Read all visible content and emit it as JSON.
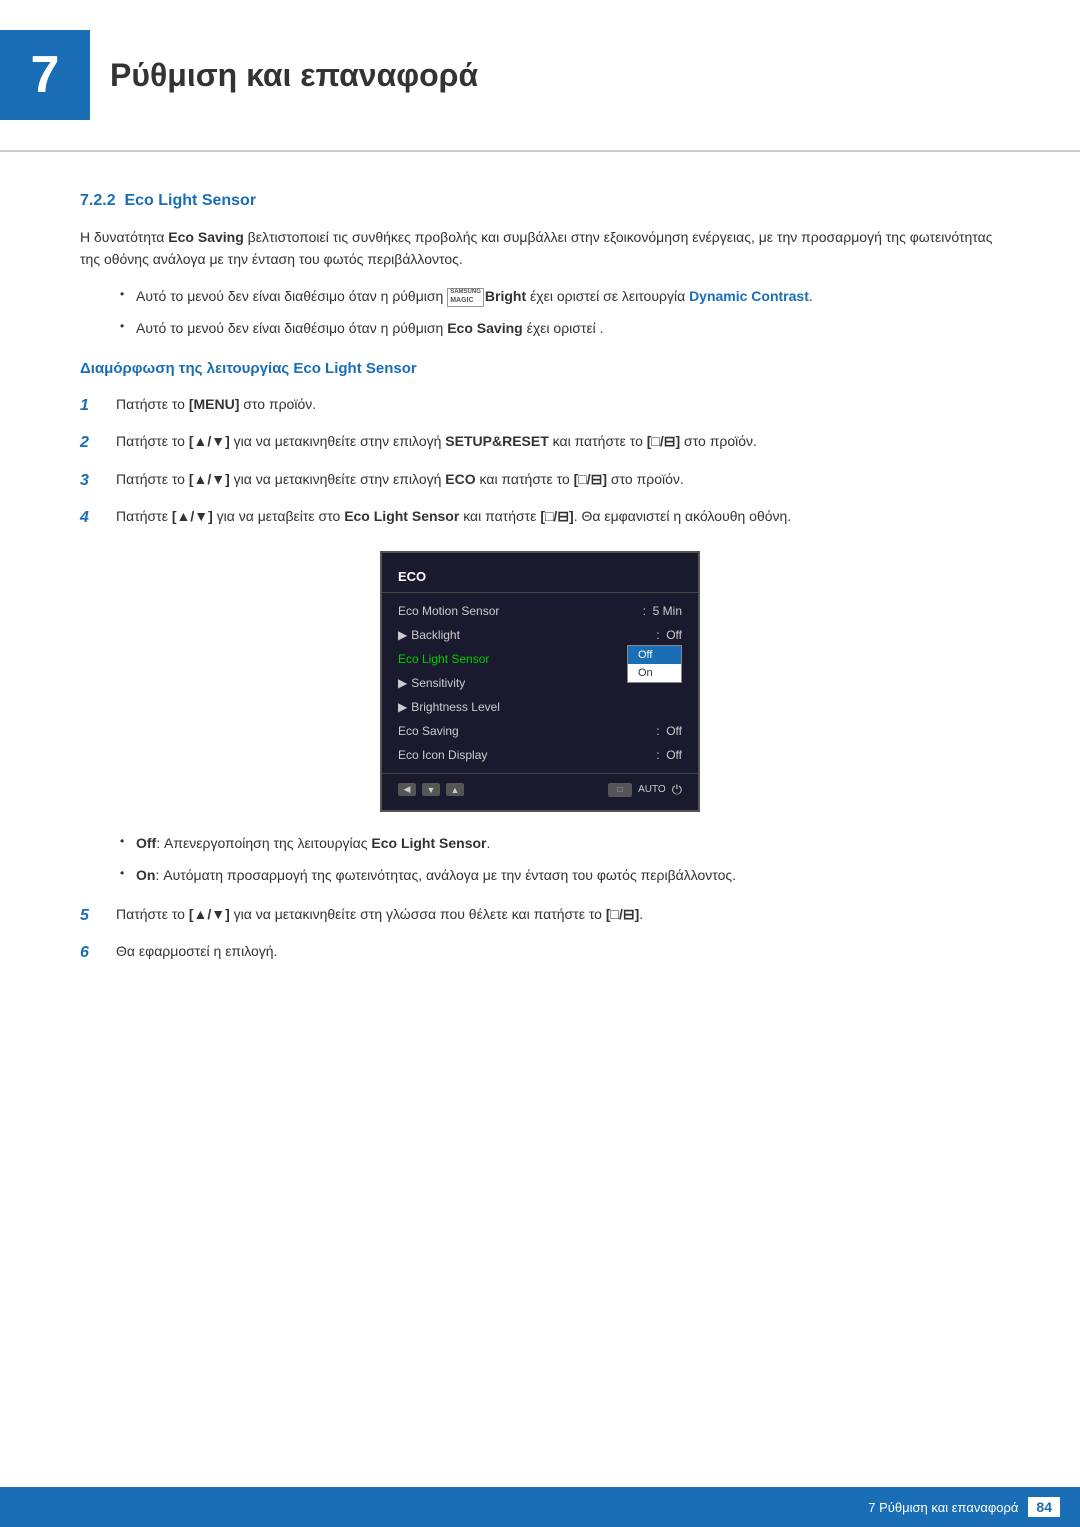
{
  "chapter": {
    "number": "7",
    "title": "Ρύθμιση και επαναφορά"
  },
  "section": {
    "id": "7.2.2",
    "title": "Eco Light Sensor"
  },
  "intro_text": "Η δυνατότητα Eco Saving βελτιστοποιεί τις συνθήκες προβολής και συμβάλλει στην εξοικονόμηση ενέργειας, με την προσαρμογή της φωτεινότητας της οθόνης ανάλογα με την ένταση του φωτός περιβάλλοντος.",
  "bullets": [
    {
      "text_before": "Αυτό το μενού δεν είναι διαθέσιμο όταν η ρύθμιση ",
      "badge": "SAMSUNG MAGIC",
      "bold_word": "Bright",
      "text_after": " έχει οριστεί σε λειτουργία ",
      "blue_word": "Dynamic Contrast",
      "end": "."
    },
    {
      "text_before": "Αυτό το μενού δεν είναι διαθέσιμο όταν η ρύθμιση ",
      "bold_word": "Eco Saving",
      "text_after": " έχει οριστεί ."
    }
  ],
  "sub_heading": "Διαμόρφωση της λειτουργίας Eco Light Sensor",
  "steps": [
    {
      "num": "1",
      "text": "Πατήστε το [MENU] στο προϊόν."
    },
    {
      "num": "2",
      "text_before": "Πατήστε το [▲/▼] για να μετακινηθείτε στην επιλογή ",
      "bold": "SETUP&RESET",
      "text_after": " και πατήστε το [□/⊟] στο προϊόν."
    },
    {
      "num": "3",
      "text_before": "Πατήστε το [▲/▼] για να μετακινηθείτε στην επιλογή ",
      "bold": "ECO",
      "text_after": " και πατήστε το [□/⊟] στο προϊόν."
    },
    {
      "num": "4",
      "text_before": "Πατήστε [▲/▼] για να μεταβείτε στο ",
      "bold": "Eco Light Sensor",
      "text_after": " και πατήστε [□/⊟]. Θα εμφανιστεί η ακόλουθη οθόνη."
    }
  ],
  "eco_menu": {
    "title": "ECO",
    "items": [
      {
        "label": "Eco Motion Sensor",
        "value": "5 Min",
        "arrow": false,
        "selected": false
      },
      {
        "label": "Backlight",
        "value": "Off",
        "arrow": true,
        "selected": false
      },
      {
        "label": "Eco Light Sensor",
        "value": "",
        "arrow": false,
        "selected": true,
        "dropdown": [
          "Off",
          "On"
        ]
      },
      {
        "label": "Sensitivity",
        "value": "",
        "arrow": true,
        "selected": false
      },
      {
        "label": "Brightness Level",
        "value": "",
        "arrow": true,
        "selected": false
      },
      {
        "label": "Eco Saving",
        "value": "Off",
        "arrow": false,
        "selected": false
      },
      {
        "label": "Eco Icon Display",
        "value": "Off",
        "arrow": false,
        "selected": false
      }
    ]
  },
  "option_bullets": [
    {
      "key": "Off",
      "colon": ": ",
      "text": "Απενεργοποίηση της λειτουργίας ",
      "bold": "Eco Light Sensor",
      "end": "."
    },
    {
      "key": "On",
      "colon": ": ",
      "text": "Αυτόματη προσαρμογή της φωτεινότητας, ανάλογα με την ένταση του φωτός περιβάλλοντος."
    }
  ],
  "steps_after": [
    {
      "num": "5",
      "text": "Πατήστε το [▲/▼] για να μετακινηθείτε στη γλώσσα που θέλετε και πατήστε το [□/⊟]."
    },
    {
      "num": "6",
      "text": "Θα εφαρμοστεί η επιλογή."
    }
  ],
  "footer": {
    "chapter_label": "7 Ρύθμιση και επαναφορά",
    "page_number": "84"
  }
}
